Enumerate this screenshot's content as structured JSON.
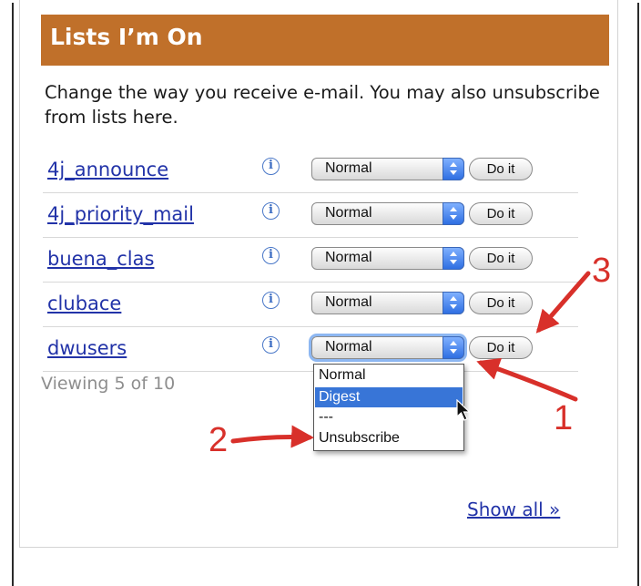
{
  "panel": {
    "title": "Lists I’m On",
    "intro": "Change the way you receive e-mail. You may also unsubscribe from lists here.",
    "header_color": "#c0702a"
  },
  "lists": [
    {
      "name": "4j_announce",
      "delivery": "Normal",
      "action": "Do it"
    },
    {
      "name": "4j_priority_mail",
      "delivery": "Normal",
      "action": "Do it"
    },
    {
      "name": "buena_clas",
      "delivery": "Normal",
      "action": "Do it"
    },
    {
      "name": "clubace",
      "delivery": "Normal",
      "action": "Do it"
    },
    {
      "name": "dwusers",
      "delivery": "Normal",
      "action": "Do it"
    }
  ],
  "info_icon": "info-icon",
  "viewing_text": "Viewing 5 of 10",
  "dropdown": {
    "options": [
      "Normal",
      "Digest",
      "---",
      "Unsubscribe"
    ],
    "highlighted": "Digest"
  },
  "show_all": "Show all »",
  "annotations": {
    "labels": [
      "1",
      "2",
      "3"
    ],
    "color": "#d8302a"
  }
}
